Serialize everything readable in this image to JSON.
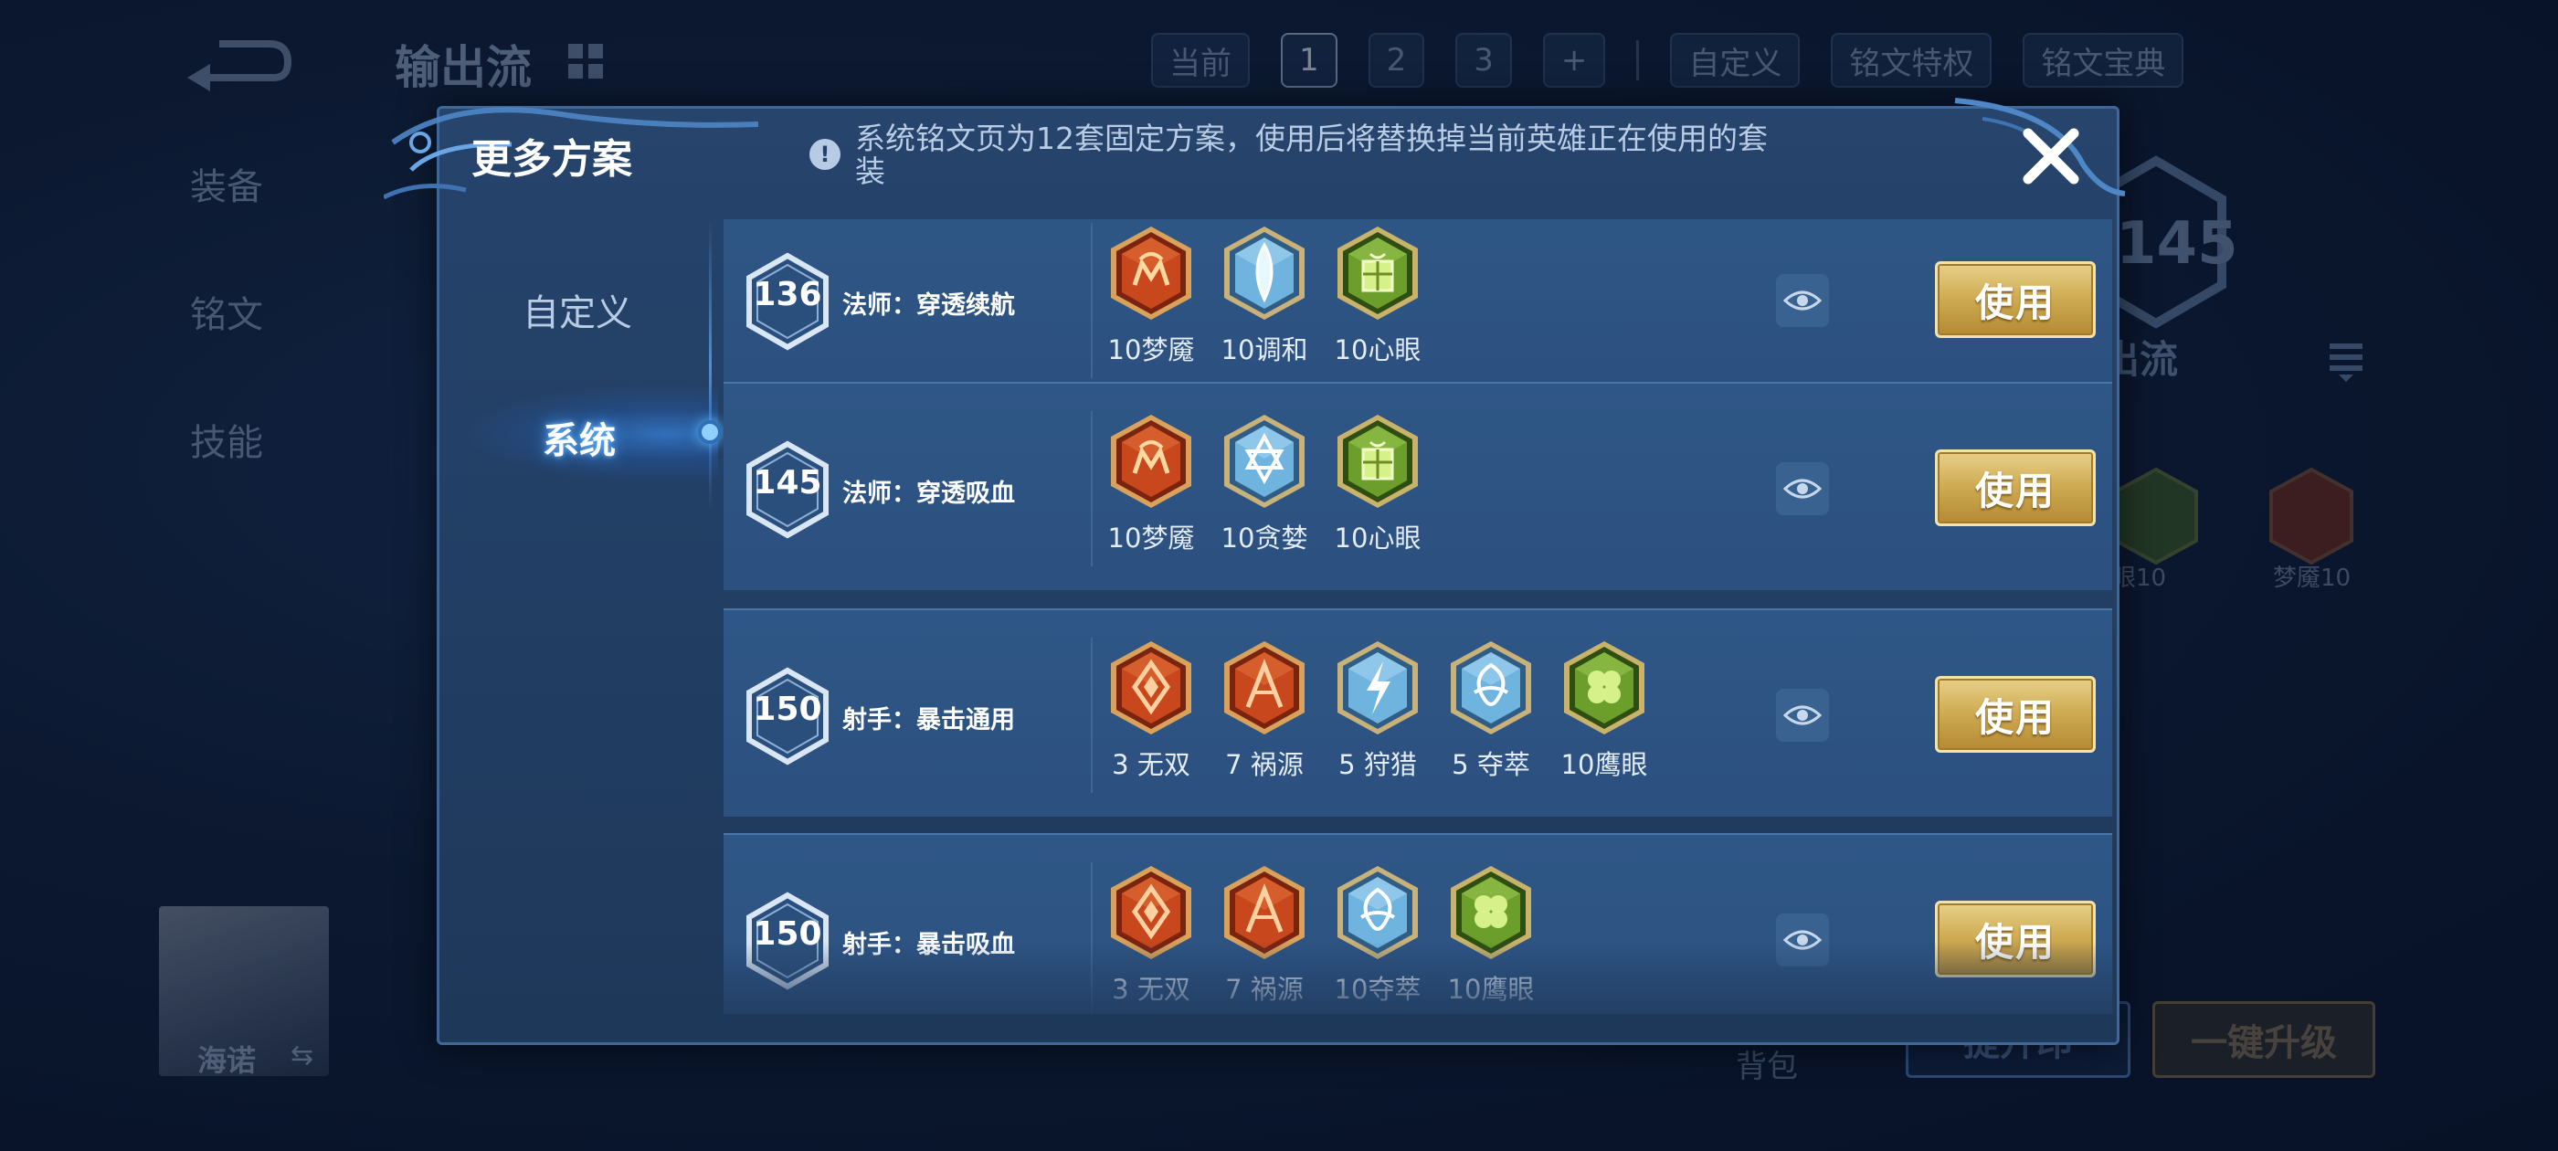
{
  "background": {
    "title": "输出流",
    "tabs": {
      "current_label": "当前",
      "pages": [
        "1",
        "2",
        "3"
      ],
      "add_label": "+",
      "custom_label": "自定义",
      "privilege_label": "铭文特权",
      "handbook_label": "铭文宝典"
    },
    "side_menu": [
      "装备",
      "铭文",
      "技能"
    ],
    "level_number": "145",
    "scheme_name": "出流",
    "runes": [
      {
        "label": "眼10",
        "color": "green"
      },
      {
        "label": "梦魇10",
        "color": "red"
      }
    ],
    "hero_name": "海诺",
    "bag_label": "背包",
    "buttons": {
      "upgrade_label": "提升印",
      "one_click_label": "一键升级"
    }
  },
  "modal": {
    "title": "更多方案",
    "notice": "系统铭文页为12套固定方案，使用后将替换掉当前英雄正在使用的套装",
    "tabs": {
      "custom": "自定义",
      "system": "系统"
    },
    "use_label": "使用",
    "schemes": [
      {
        "level": "136",
        "name": "法师：穿透续航",
        "runes": [
          {
            "label": "10梦魇",
            "color": "red",
            "glyph": "m"
          },
          {
            "label": "10调和",
            "color": "blue",
            "glyph": "drop"
          },
          {
            "label": "10心眼",
            "color": "green",
            "glyph": "gift"
          }
        ]
      },
      {
        "level": "145",
        "name": "法师：穿透吸血",
        "runes": [
          {
            "label": "10梦魇",
            "color": "red",
            "glyph": "m"
          },
          {
            "label": "10贪婪",
            "color": "blue",
            "glyph": "star"
          },
          {
            "label": "10心眼",
            "color": "green",
            "glyph": "gift"
          }
        ]
      },
      {
        "level": "150",
        "name": "射手：暴击通用",
        "runes": [
          {
            "label": "3 无双",
            "color": "red",
            "glyph": "diamond"
          },
          {
            "label": "7 祸源",
            "color": "red",
            "glyph": "fan"
          },
          {
            "label": "5 狩猎",
            "color": "blue",
            "glyph": "bolt"
          },
          {
            "label": "5 夺萃",
            "color": "blue",
            "glyph": "knot"
          },
          {
            "label": "10鹰眼",
            "color": "green",
            "glyph": "clover"
          }
        ]
      },
      {
        "level": "150",
        "name": "射手：暴击吸血",
        "runes": [
          {
            "label": "3 无双",
            "color": "red",
            "glyph": "diamond"
          },
          {
            "label": "7 祸源",
            "color": "red",
            "glyph": "fan"
          },
          {
            "label": "10夺萃",
            "color": "blue",
            "glyph": "knot"
          },
          {
            "label": "10鹰眼",
            "color": "green",
            "glyph": "clover"
          }
        ]
      }
    ]
  },
  "colors": {
    "rune_red": "#c8471d",
    "rune_blue": "#6fb4df",
    "rune_green": "#6c9e2c",
    "use_button_gold": "#d0ad55",
    "panel_blue": "#2c5080"
  }
}
